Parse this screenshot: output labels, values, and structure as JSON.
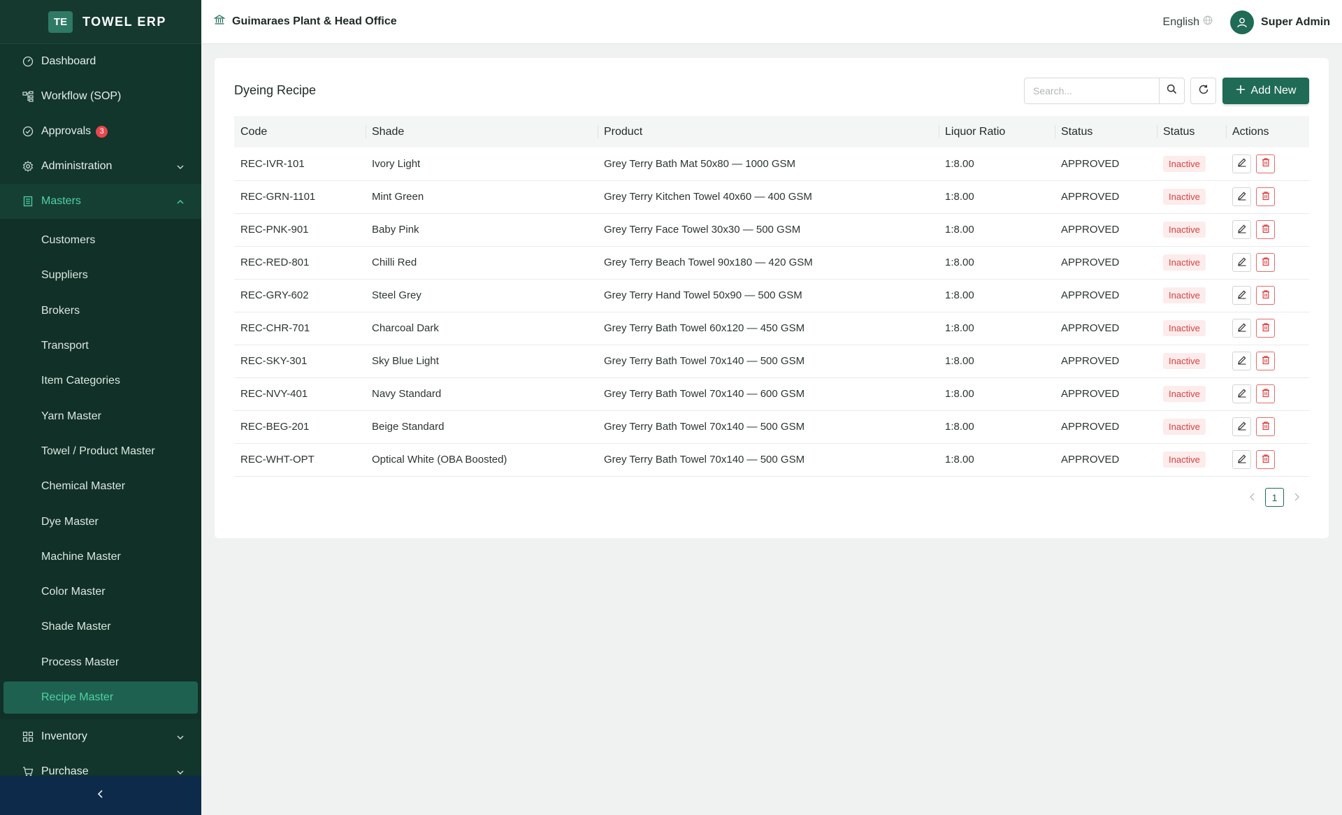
{
  "brand": {
    "logo": "TE",
    "name": "TOWEL ERP"
  },
  "sidebar": {
    "items": [
      {
        "label": "Dashboard",
        "icon": "dashboard-icon"
      },
      {
        "label": "Workflow (SOP)",
        "icon": "workflow-icon"
      },
      {
        "label": "Approvals",
        "icon": "check-circle-icon",
        "badge": "3"
      },
      {
        "label": "Administration",
        "icon": "gear-icon"
      },
      {
        "label": "Masters",
        "icon": "document-icon"
      }
    ],
    "masters_sub": [
      "Customers",
      "Suppliers",
      "Brokers",
      "Transport",
      "Item Categories",
      "Yarn Master",
      "Towel / Product Master",
      "Chemical Master",
      "Dye Master",
      "Machine Master",
      "Color Master",
      "Shade Master",
      "Process Master",
      "Recipe Master"
    ],
    "after": [
      {
        "label": "Inventory",
        "icon": "grid-icon"
      },
      {
        "label": "Purchase",
        "icon": "cart-icon"
      }
    ]
  },
  "header": {
    "org": "Guimaraes Plant & Head Office",
    "language": "English",
    "user": "Super Admin"
  },
  "page": {
    "title": "Dyeing Recipe",
    "search_placeholder": "Search...",
    "add_label": "Add New"
  },
  "table": {
    "columns": [
      "Code",
      "Shade",
      "Product",
      "Liquor Ratio",
      "Status",
      "Status",
      "Actions"
    ],
    "rows": [
      {
        "code": "REC-IVR-101",
        "shade": "Ivory Light",
        "product": "Grey Terry Bath Mat 50x80 — 1000 GSM",
        "ratio": "1:8.00",
        "approval": "APPROVED",
        "status": "Inactive"
      },
      {
        "code": "REC-GRN-1101",
        "shade": "Mint Green",
        "product": "Grey Terry Kitchen Towel 40x60 — 400 GSM",
        "ratio": "1:8.00",
        "approval": "APPROVED",
        "status": "Inactive"
      },
      {
        "code": "REC-PNK-901",
        "shade": "Baby Pink",
        "product": "Grey Terry Face Towel 30x30 — 500 GSM",
        "ratio": "1:8.00",
        "approval": "APPROVED",
        "status": "Inactive"
      },
      {
        "code": "REC-RED-801",
        "shade": "Chilli Red",
        "product": "Grey Terry Beach Towel 90x180 — 420 GSM",
        "ratio": "1:8.00",
        "approval": "APPROVED",
        "status": "Inactive"
      },
      {
        "code": "REC-GRY-602",
        "shade": "Steel Grey",
        "product": "Grey Terry Hand Towel 50x90 — 500 GSM",
        "ratio": "1:8.00",
        "approval": "APPROVED",
        "status": "Inactive"
      },
      {
        "code": "REC-CHR-701",
        "shade": "Charcoal Dark",
        "product": "Grey Terry Bath Towel 60x120 — 450 GSM",
        "ratio": "1:8.00",
        "approval": "APPROVED",
        "status": "Inactive"
      },
      {
        "code": "REC-SKY-301",
        "shade": "Sky Blue Light",
        "product": "Grey Terry Bath Towel 70x140 — 500 GSM",
        "ratio": "1:8.00",
        "approval": "APPROVED",
        "status": "Inactive"
      },
      {
        "code": "REC-NVY-401",
        "shade": "Navy Standard",
        "product": "Grey Terry Bath Towel 70x140 — 600 GSM",
        "ratio": "1:8.00",
        "approval": "APPROVED",
        "status": "Inactive"
      },
      {
        "code": "REC-BEG-201",
        "shade": "Beige Standard",
        "product": "Grey Terry Bath Towel 70x140 — 500 GSM",
        "ratio": "1:8.00",
        "approval": "APPROVED",
        "status": "Inactive"
      },
      {
        "code": "REC-WHT-OPT",
        "shade": "Optical White (OBA Boosted)",
        "product": "Grey Terry Bath Towel 70x140 — 500 GSM",
        "ratio": "1:8.00",
        "approval": "APPROVED",
        "status": "Inactive"
      }
    ]
  },
  "pagination": {
    "current": "1"
  },
  "colors": {
    "sidebar": "#12352c",
    "accent": "#1f6b55",
    "active_text": "#4fd1a3",
    "danger": "#d93f3f"
  }
}
